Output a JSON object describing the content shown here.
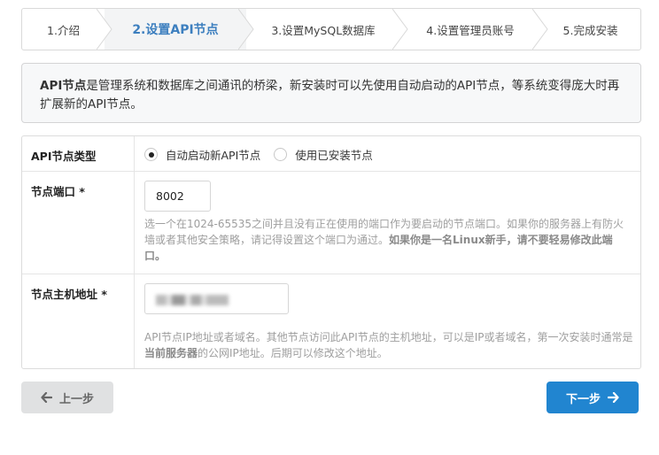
{
  "steps": [
    {
      "label": "1.介绍",
      "active": false
    },
    {
      "label": "2.设置API节点",
      "active": true
    },
    {
      "label": "3.设置MySQL数据库",
      "active": false
    },
    {
      "label": "4.设置管理员账号",
      "active": false
    },
    {
      "label": "5.完成安装",
      "active": false
    }
  ],
  "info": {
    "strong": "API节点",
    "text": "是管理系统和数据库之间通讯的桥梁，新安装时可以先使用自动启动的API节点，等系统变得庞大时再扩展新的API节点。"
  },
  "form": {
    "node_type": {
      "label": "API节点类型",
      "options": [
        {
          "label": "自动启动新API节点",
          "checked": true
        },
        {
          "label": "使用已安装节点",
          "checked": false
        }
      ]
    },
    "port": {
      "label": "节点端口 *",
      "value": "8002",
      "hint_plain": "选一个在1024-65535之间并且没有正在使用的端口作为要启动的节点端口。如果你的服务器上有防火墙或者其他安全策略，请记得设置这个端口为通过。",
      "hint_bold": "如果你是一名Linux新手，请不要轻易修改此端口。"
    },
    "host": {
      "label": "节点主机地址 *",
      "hint_pre": "API节点IP地址或者域名。其他节点访问此API节点的主机地址，可以是IP或者域名，第一次安装时通常是",
      "hint_bold": "当前服务器",
      "hint_post": "的公网IP地址。后期可以修改这个地址。"
    }
  },
  "buttons": {
    "prev": {
      "label": "上一步",
      "icon": "arrow-left-icon"
    },
    "next": {
      "label": "下一步",
      "icon": "arrow-right-icon"
    }
  },
  "colors": {
    "primary": "#2185d0",
    "active_step": "#3d7fbf"
  }
}
